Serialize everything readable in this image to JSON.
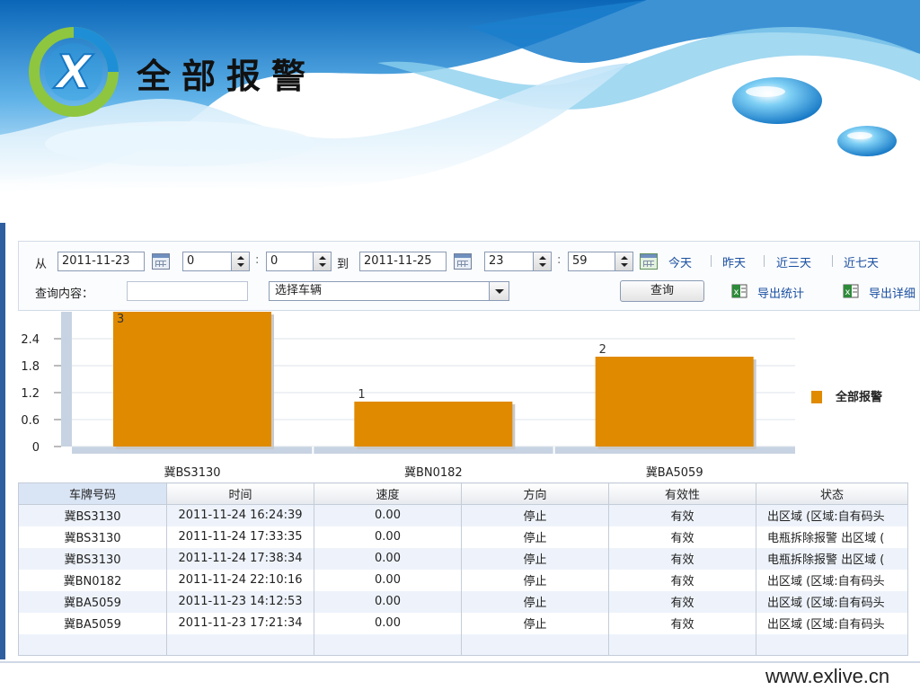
{
  "app": {
    "title": "全部报警",
    "site": "www.exlive.cn"
  },
  "filter": {
    "from_label": "从",
    "to_label": "到",
    "start_date": "2011-11-23",
    "start_hour": "0",
    "start_minute": "0",
    "end_date": "2011-11-25",
    "end_hour": "23",
    "end_minute": "59",
    "time_colon": ":",
    "quick": {
      "today": "今天",
      "yesterday": "昨天",
      "last3": "近三天",
      "last7": "近七天"
    },
    "query_label": "查询内容：",
    "query_value": "",
    "vehicle_select": "选择车辆",
    "search_button": "查询",
    "export_stats": "导出统计",
    "export_detail": "导出详细"
  },
  "chart_data": {
    "type": "bar",
    "categories": [
      "冀BS3130",
      "冀BN0182",
      "冀BA5059"
    ],
    "series": [
      {
        "name": "全部报警",
        "values": [
          3,
          1,
          2
        ]
      }
    ],
    "yticks": [
      "0",
      "0.6",
      "1.2",
      "1.8",
      "2.4"
    ],
    "ylim": [
      0,
      3
    ],
    "legend": "right",
    "grid": true,
    "color": "#e08a00"
  },
  "table": {
    "columns": [
      "车牌号码",
      "时间",
      "速度",
      "方向",
      "有效性",
      "状态"
    ],
    "rows": [
      [
        "冀BS3130",
        "2011-11-24 16:24:39",
        "0.00",
        "停止",
        "有效",
        "出区域 (区域:自有码头"
      ],
      [
        "冀BS3130",
        "2011-11-24 17:33:35",
        "0.00",
        "停止",
        "有效",
        "电瓶拆除报警 出区域 ("
      ],
      [
        "冀BS3130",
        "2011-11-24 17:38:34",
        "0.00",
        "停止",
        "有效",
        "电瓶拆除报警 出区域 ("
      ],
      [
        "冀BN0182",
        "2011-11-24 22:10:16",
        "0.00",
        "停止",
        "有效",
        "出区域 (区域:自有码头"
      ],
      [
        "冀BA5059",
        "2011-11-23 14:12:53",
        "0.00",
        "停止",
        "有效",
        "出区域 (区域:自有码头"
      ],
      [
        "冀BA5059",
        "2011-11-23 17:21:34",
        "0.00",
        "停止",
        "有效",
        "出区域 (区域:自有码头"
      ]
    ]
  }
}
